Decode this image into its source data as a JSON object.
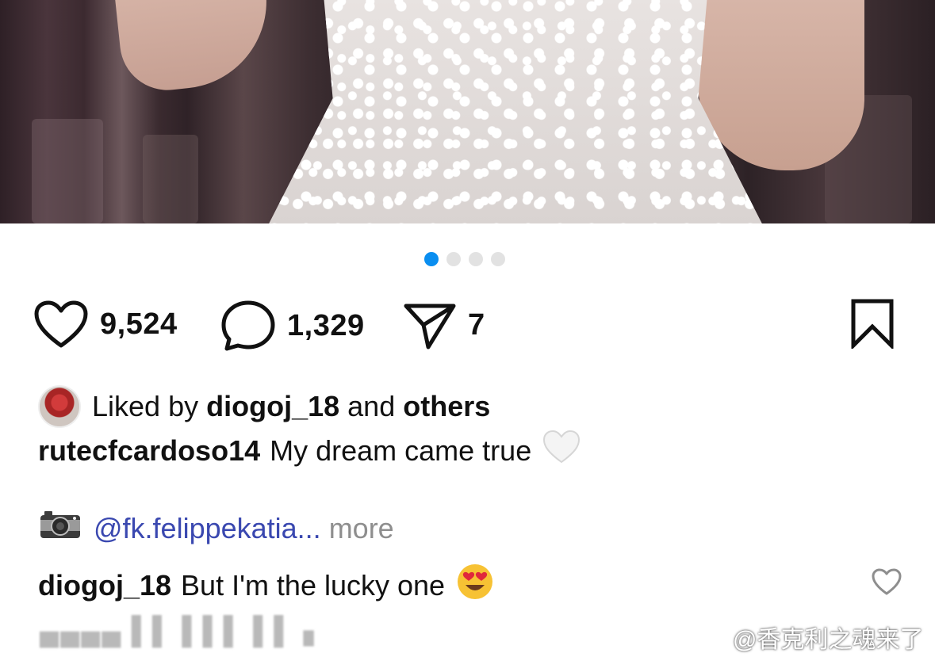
{
  "post": {
    "carousel": {
      "total": 4,
      "active_index": 0
    },
    "actions": {
      "likes": "9,524",
      "comments": "1,329",
      "shares": "7"
    },
    "liked_by": {
      "prefix": "Liked by",
      "user": "diogoj_18",
      "conjunction": "and",
      "others": "others"
    },
    "caption": {
      "username": "rutecfcardoso14",
      "text": "My dream came true",
      "emoji": "🤍"
    },
    "credit": {
      "icon": "camera-icon",
      "mention": "@fk.felippekatia...",
      "more_label": "more"
    },
    "comment": {
      "username": "diogoj_18",
      "text": "But I'm the lucky one",
      "emoji": "😍"
    },
    "watermark": {
      "icon": "weibo-logo-icon",
      "text": "@香克利之魂来了"
    },
    "colors": {
      "active_dot": "#0a8ef0",
      "inactive_dot": "#e2e2e2",
      "mention": "#3a48b0",
      "muted": "#8e8e8e"
    }
  }
}
